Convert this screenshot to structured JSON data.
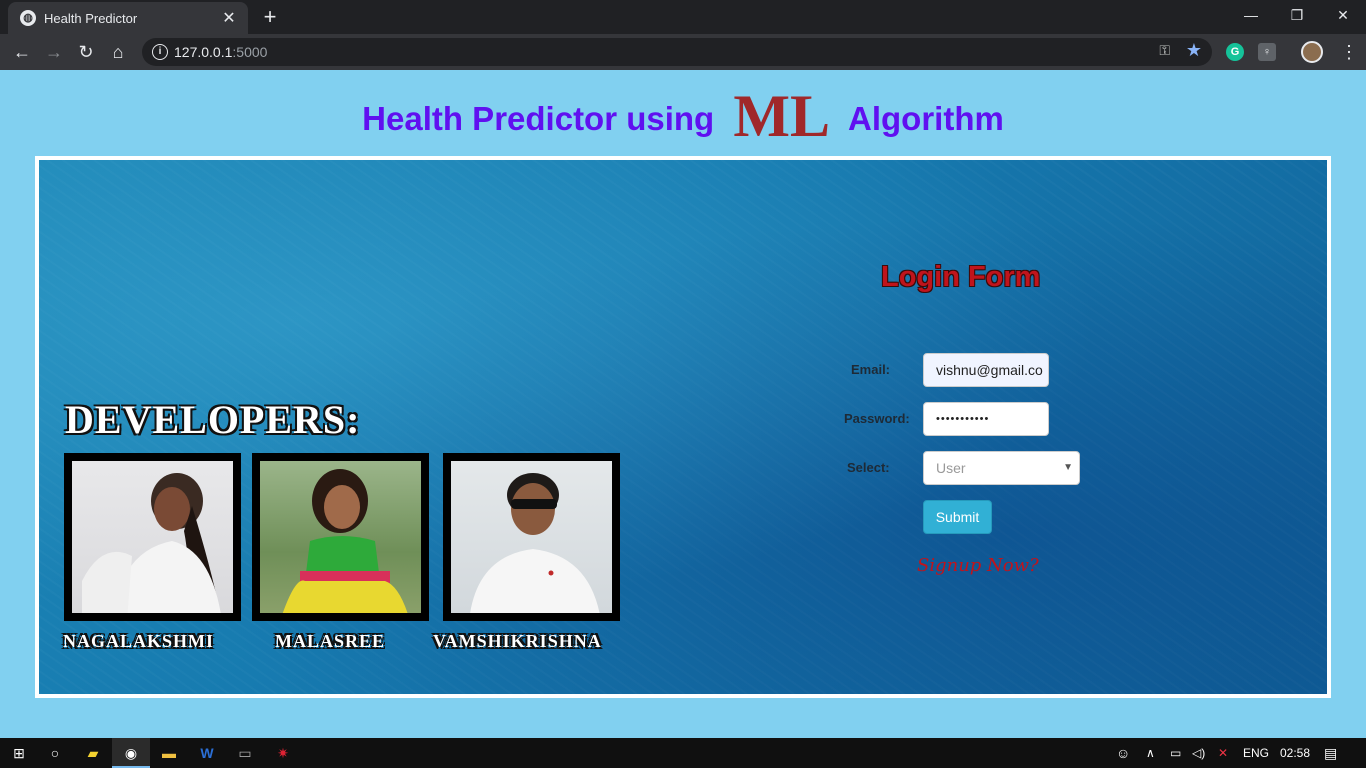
{
  "browser": {
    "tab_title": "Health Predictor",
    "new_tab": "+",
    "url_host": "127.0.0.1",
    "url_port": ":5000",
    "minimize": "—",
    "restore": "❐",
    "close": "✕"
  },
  "page": {
    "heading_prefix": "Health Predictor using",
    "heading_highlight": "ML",
    "heading_suffix": "Algorithm"
  },
  "developers": {
    "title": "DEVELOPERS:",
    "people": [
      {
        "name": "NAGALAKSHMI"
      },
      {
        "name": "MALASREE"
      },
      {
        "name": "VAMSHIKRISHNA"
      }
    ]
  },
  "login": {
    "title": "Login Form",
    "email_label": "Email:",
    "email_value": "vishnu@gmail.co",
    "password_label": "Password:",
    "password_value": "•••••••••••",
    "select_label": "Select:",
    "select_value": "User",
    "submit_label": "Submit",
    "signup_label": "Signup Now?"
  },
  "taskbar": {
    "language": "ENG",
    "time": "02:58"
  },
  "colors": {
    "page_bg": "#81d0f0",
    "heading": "#6010f0",
    "ml_highlight": "#a0282a",
    "login_title": "#c0141c",
    "submit_bg": "#31b0d5"
  }
}
